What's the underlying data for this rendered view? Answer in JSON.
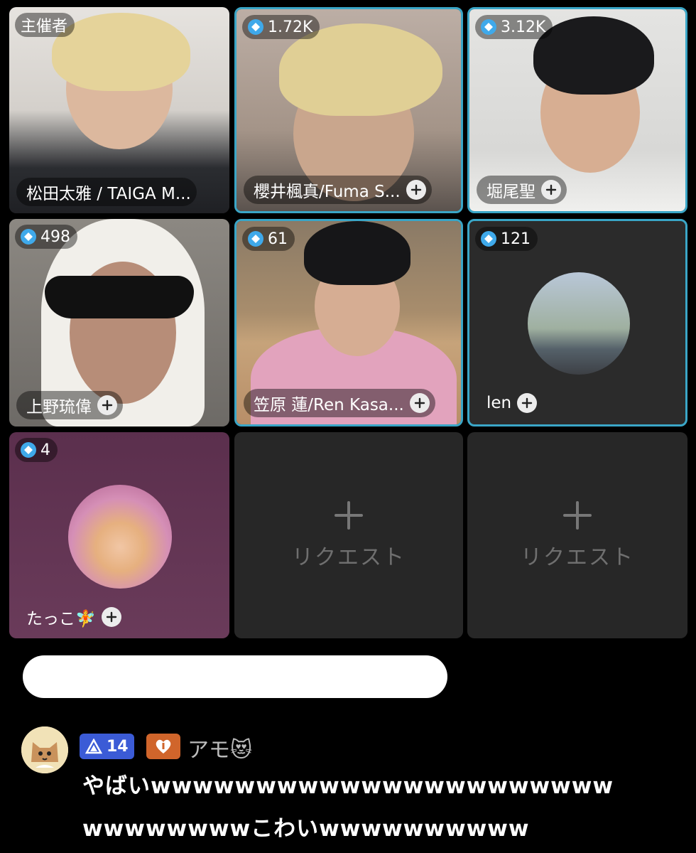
{
  "tiles": [
    {
      "badge": "主催者",
      "name": "松田太雅 / TAIGA M..."
    },
    {
      "badge": "1.72K",
      "name": "櫻井楓真/Fuma S..."
    },
    {
      "badge": "3.12K",
      "name": "堀尾聖"
    },
    {
      "badge": "498",
      "name": "上野琉偉"
    },
    {
      "badge": "61",
      "name": "笠原 蓮/Ren Kasa..."
    },
    {
      "badge": "121",
      "name": "len"
    },
    {
      "badge": "4",
      "name": "たっこ🧚"
    }
  ],
  "request_label": "リクエスト",
  "chat": {
    "level": "14",
    "username": "アモ😻",
    "message_line1": "やばいwwwwwwwwwwwwwwwwwwwwww",
    "message_line2": "wwwwwwwwこわいwwwwwwwwww"
  },
  "colors": {
    "active_border": "#3aa6c7",
    "gem": "#3fa9ea",
    "level_badge": "#3b5bd6",
    "heart_badge": "#d0652b"
  }
}
